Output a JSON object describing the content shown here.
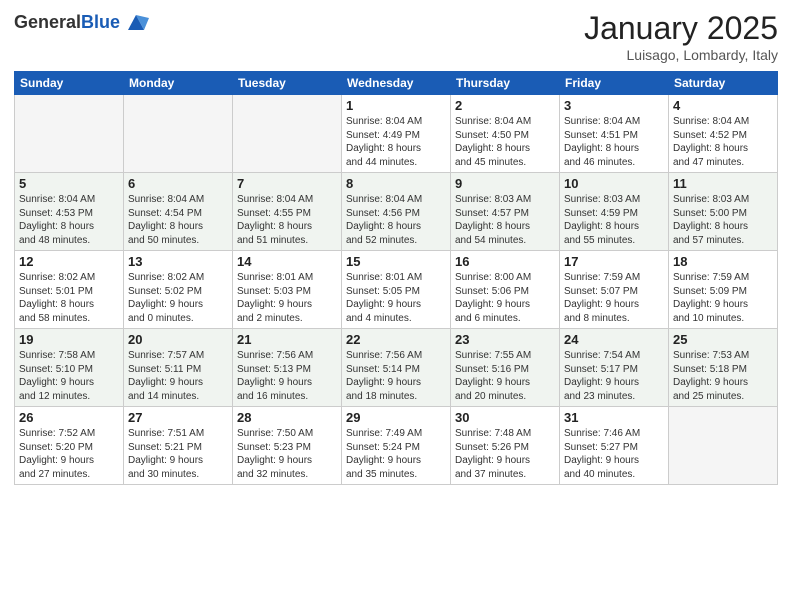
{
  "header": {
    "logo_general": "General",
    "logo_blue": "Blue",
    "month_title": "January 2025",
    "location": "Luisago, Lombardy, Italy"
  },
  "days_of_week": [
    "Sunday",
    "Monday",
    "Tuesday",
    "Wednesday",
    "Thursday",
    "Friday",
    "Saturday"
  ],
  "weeks": [
    {
      "days": [
        {
          "number": "",
          "info": ""
        },
        {
          "number": "",
          "info": ""
        },
        {
          "number": "",
          "info": ""
        },
        {
          "number": "1",
          "info": "Sunrise: 8:04 AM\nSunset: 4:49 PM\nDaylight: 8 hours\nand 44 minutes."
        },
        {
          "number": "2",
          "info": "Sunrise: 8:04 AM\nSunset: 4:50 PM\nDaylight: 8 hours\nand 45 minutes."
        },
        {
          "number": "3",
          "info": "Sunrise: 8:04 AM\nSunset: 4:51 PM\nDaylight: 8 hours\nand 46 minutes."
        },
        {
          "number": "4",
          "info": "Sunrise: 8:04 AM\nSunset: 4:52 PM\nDaylight: 8 hours\nand 47 minutes."
        }
      ]
    },
    {
      "days": [
        {
          "number": "5",
          "info": "Sunrise: 8:04 AM\nSunset: 4:53 PM\nDaylight: 8 hours\nand 48 minutes."
        },
        {
          "number": "6",
          "info": "Sunrise: 8:04 AM\nSunset: 4:54 PM\nDaylight: 8 hours\nand 50 minutes."
        },
        {
          "number": "7",
          "info": "Sunrise: 8:04 AM\nSunset: 4:55 PM\nDaylight: 8 hours\nand 51 minutes."
        },
        {
          "number": "8",
          "info": "Sunrise: 8:04 AM\nSunset: 4:56 PM\nDaylight: 8 hours\nand 52 minutes."
        },
        {
          "number": "9",
          "info": "Sunrise: 8:03 AM\nSunset: 4:57 PM\nDaylight: 8 hours\nand 54 minutes."
        },
        {
          "number": "10",
          "info": "Sunrise: 8:03 AM\nSunset: 4:59 PM\nDaylight: 8 hours\nand 55 minutes."
        },
        {
          "number": "11",
          "info": "Sunrise: 8:03 AM\nSunset: 5:00 PM\nDaylight: 8 hours\nand 57 minutes."
        }
      ]
    },
    {
      "days": [
        {
          "number": "12",
          "info": "Sunrise: 8:02 AM\nSunset: 5:01 PM\nDaylight: 8 hours\nand 58 minutes."
        },
        {
          "number": "13",
          "info": "Sunrise: 8:02 AM\nSunset: 5:02 PM\nDaylight: 9 hours\nand 0 minutes."
        },
        {
          "number": "14",
          "info": "Sunrise: 8:01 AM\nSunset: 5:03 PM\nDaylight: 9 hours\nand 2 minutes."
        },
        {
          "number": "15",
          "info": "Sunrise: 8:01 AM\nSunset: 5:05 PM\nDaylight: 9 hours\nand 4 minutes."
        },
        {
          "number": "16",
          "info": "Sunrise: 8:00 AM\nSunset: 5:06 PM\nDaylight: 9 hours\nand 6 minutes."
        },
        {
          "number": "17",
          "info": "Sunrise: 7:59 AM\nSunset: 5:07 PM\nDaylight: 9 hours\nand 8 minutes."
        },
        {
          "number": "18",
          "info": "Sunrise: 7:59 AM\nSunset: 5:09 PM\nDaylight: 9 hours\nand 10 minutes."
        }
      ]
    },
    {
      "days": [
        {
          "number": "19",
          "info": "Sunrise: 7:58 AM\nSunset: 5:10 PM\nDaylight: 9 hours\nand 12 minutes."
        },
        {
          "number": "20",
          "info": "Sunrise: 7:57 AM\nSunset: 5:11 PM\nDaylight: 9 hours\nand 14 minutes."
        },
        {
          "number": "21",
          "info": "Sunrise: 7:56 AM\nSunset: 5:13 PM\nDaylight: 9 hours\nand 16 minutes."
        },
        {
          "number": "22",
          "info": "Sunrise: 7:56 AM\nSunset: 5:14 PM\nDaylight: 9 hours\nand 18 minutes."
        },
        {
          "number": "23",
          "info": "Sunrise: 7:55 AM\nSunset: 5:16 PM\nDaylight: 9 hours\nand 20 minutes."
        },
        {
          "number": "24",
          "info": "Sunrise: 7:54 AM\nSunset: 5:17 PM\nDaylight: 9 hours\nand 23 minutes."
        },
        {
          "number": "25",
          "info": "Sunrise: 7:53 AM\nSunset: 5:18 PM\nDaylight: 9 hours\nand 25 minutes."
        }
      ]
    },
    {
      "days": [
        {
          "number": "26",
          "info": "Sunrise: 7:52 AM\nSunset: 5:20 PM\nDaylight: 9 hours\nand 27 minutes."
        },
        {
          "number": "27",
          "info": "Sunrise: 7:51 AM\nSunset: 5:21 PM\nDaylight: 9 hours\nand 30 minutes."
        },
        {
          "number": "28",
          "info": "Sunrise: 7:50 AM\nSunset: 5:23 PM\nDaylight: 9 hours\nand 32 minutes."
        },
        {
          "number": "29",
          "info": "Sunrise: 7:49 AM\nSunset: 5:24 PM\nDaylight: 9 hours\nand 35 minutes."
        },
        {
          "number": "30",
          "info": "Sunrise: 7:48 AM\nSunset: 5:26 PM\nDaylight: 9 hours\nand 37 minutes."
        },
        {
          "number": "31",
          "info": "Sunrise: 7:46 AM\nSunset: 5:27 PM\nDaylight: 9 hours\nand 40 minutes."
        },
        {
          "number": "",
          "info": ""
        }
      ]
    }
  ]
}
